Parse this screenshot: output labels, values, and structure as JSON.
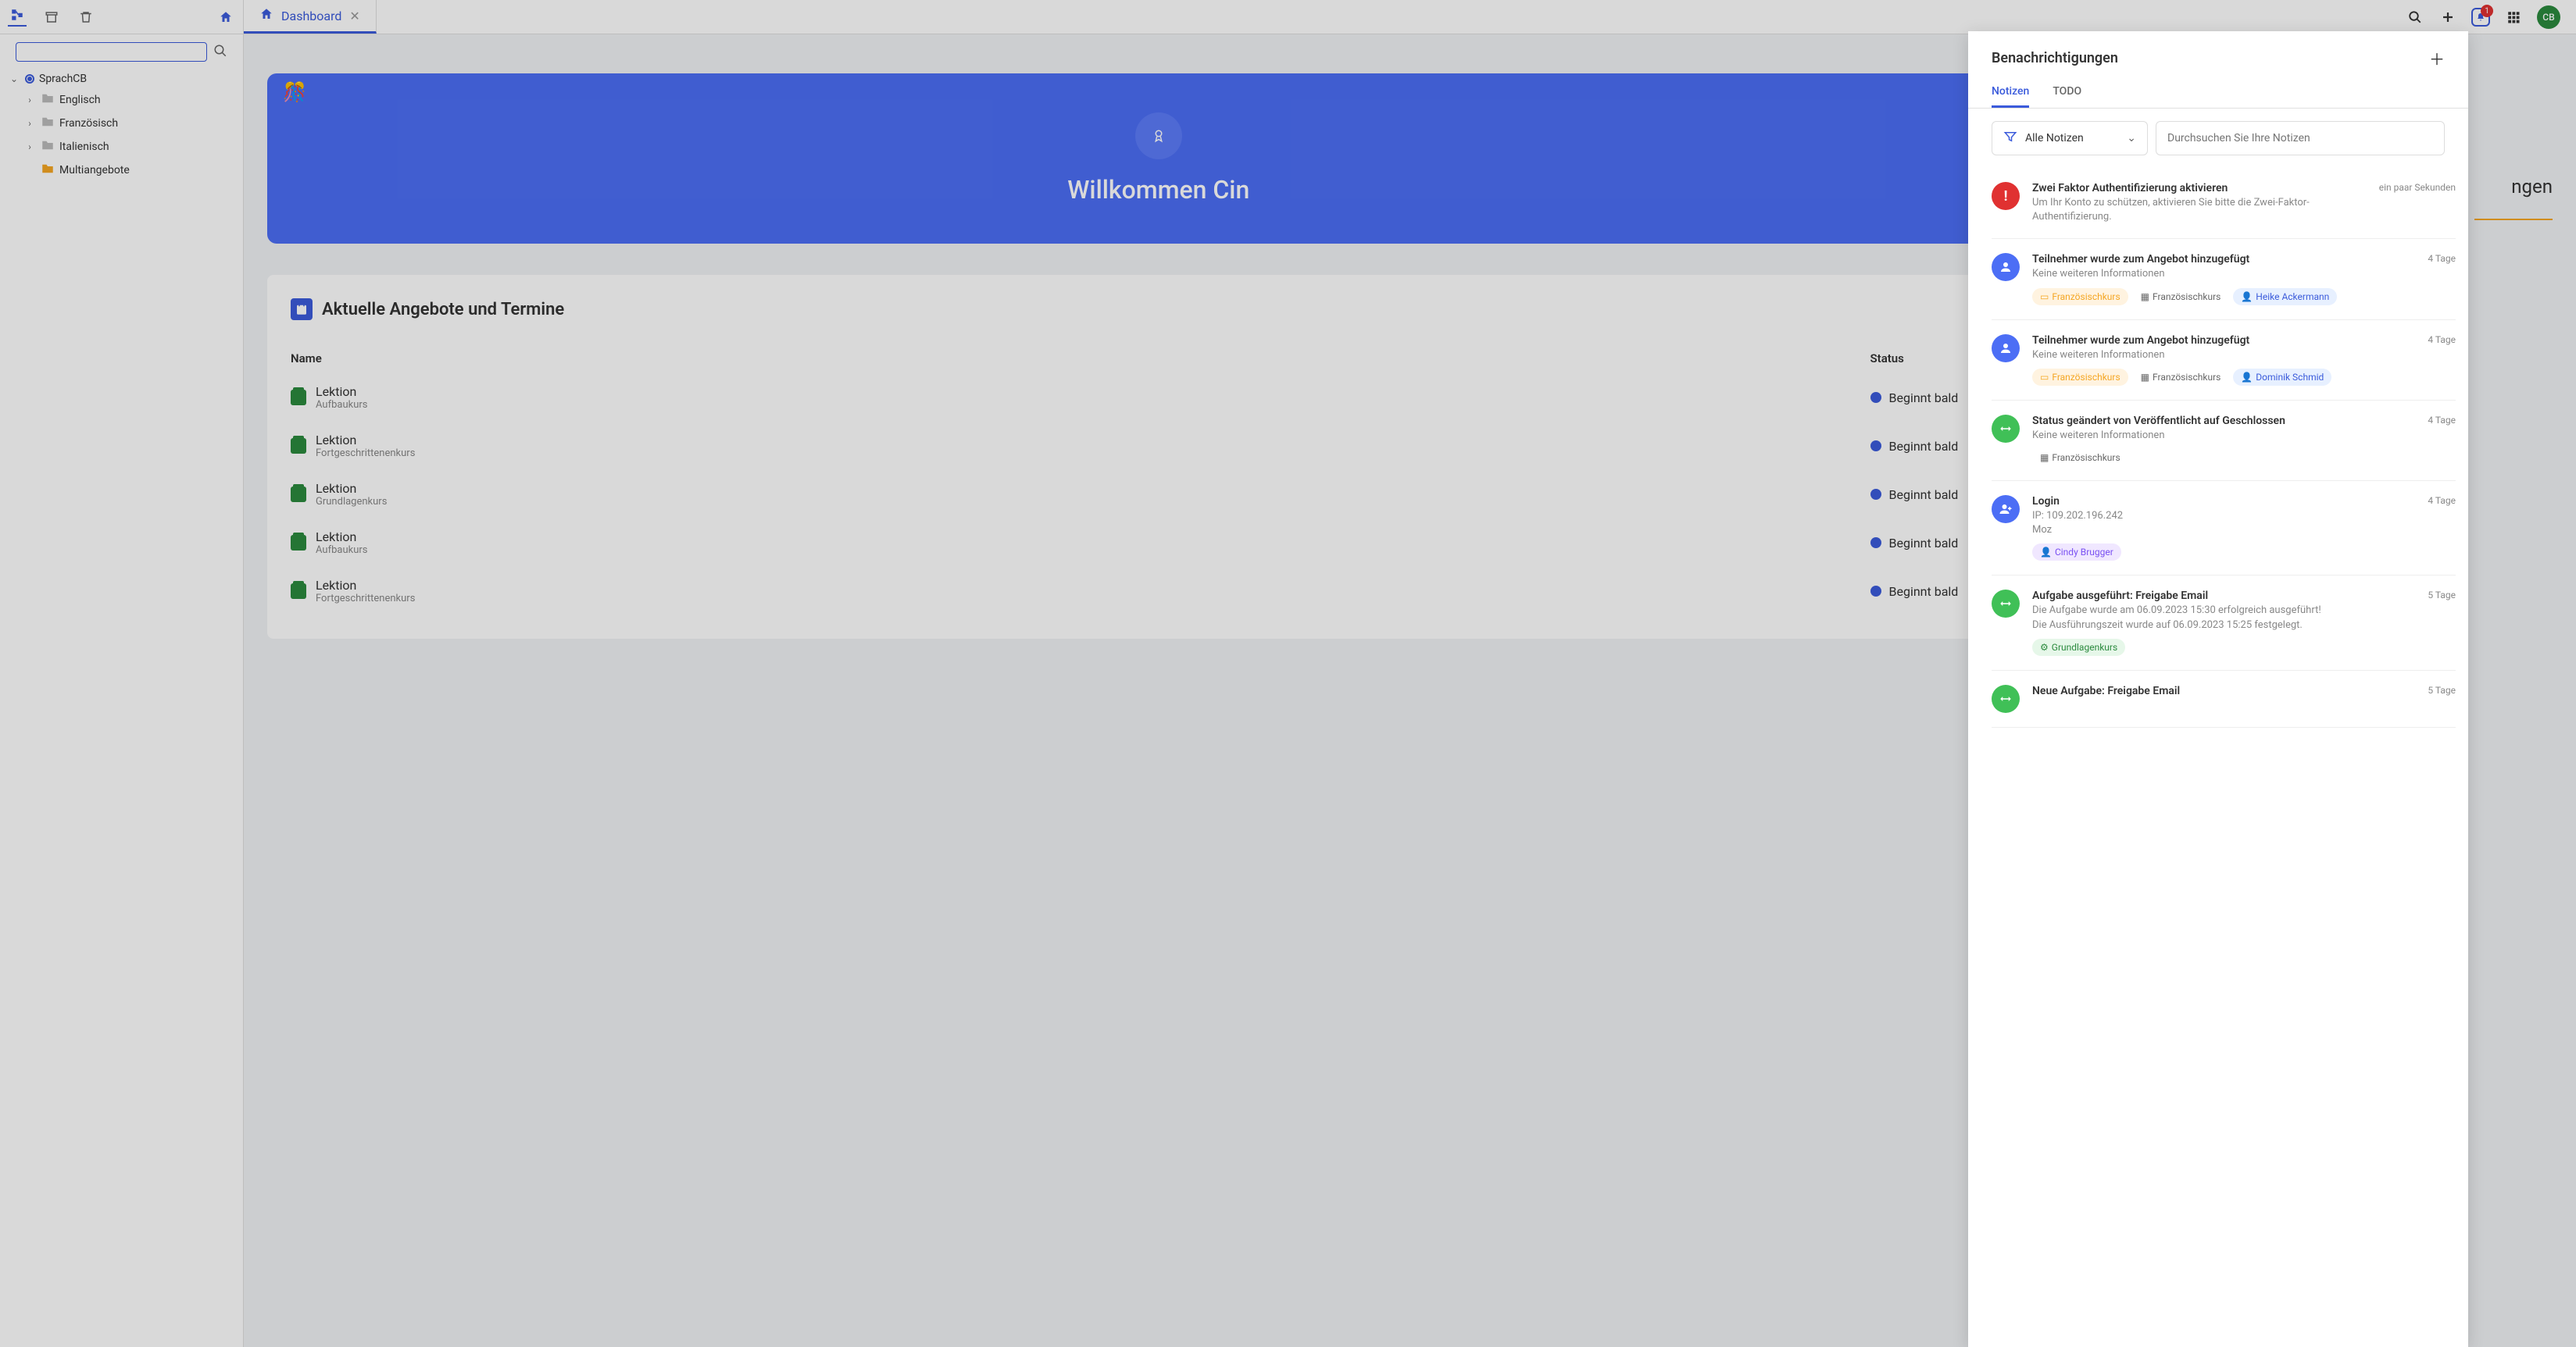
{
  "sidebar": {
    "root": "SprachCB",
    "items": [
      "Englisch",
      "Französisch",
      "Italienisch"
    ],
    "special": "Multiangebote"
  },
  "tab": {
    "label": "Dashboard"
  },
  "welcome": {
    "text": "Willkommen Cin"
  },
  "section": {
    "title": "Aktuelle Angebote und Termine",
    "col_name": "Name",
    "col_status": "Status",
    "rows": [
      {
        "title": "Lektion",
        "sub": "Aufbaukurs",
        "status": "Beginnt bald"
      },
      {
        "title": "Lektion",
        "sub": "Fortgeschrittenenkurs",
        "status": "Beginnt bald"
      },
      {
        "title": "Lektion",
        "sub": "Grundlagenkurs",
        "status": "Beginnt bald"
      },
      {
        "title": "Lektion",
        "sub": "Aufbaukurs",
        "status": "Beginnt bald"
      },
      {
        "title": "Lektion",
        "sub": "Fortgeschrittenenkurs",
        "status": "Beginnt bald"
      }
    ]
  },
  "topbar": {
    "badge": "1",
    "avatar": "CB"
  },
  "side_text": "ngen",
  "panel": {
    "title": "Benachrichtigungen",
    "tab_notes": "Notizen",
    "tab_todo": "TODO",
    "filter_label": "Alle Notizen",
    "search_placeholder": "Durchsuchen Sie Ihre Notizen",
    "items": [
      {
        "icon": "red",
        "glyph": "!",
        "title": "Zwei Faktor Authentifizierung aktivieren",
        "desc": "Um Ihr Konto zu schützen, aktivieren Sie bitte die Zwei-Faktor-Authentifizierung.",
        "time": "ein paar Sekunden",
        "tags": []
      },
      {
        "icon": "blue",
        "glyph": "person",
        "title": "Teilnehmer wurde zum Angebot hinzugefügt",
        "desc": "Keine weiteren Informationen",
        "time": "4 Tage",
        "tags": [
          {
            "cls": "orange",
            "icon": "card",
            "text": "Französischkurs"
          },
          {
            "cls": "gray",
            "icon": "grid",
            "text": "Französischkurs"
          },
          {
            "cls": "blue",
            "icon": "person",
            "text": "Heike Ackermann"
          }
        ]
      },
      {
        "icon": "blue",
        "glyph": "person",
        "title": "Teilnehmer wurde zum Angebot hinzugefügt",
        "desc": "Keine weiteren Informationen",
        "time": "4 Tage",
        "tags": [
          {
            "cls": "orange",
            "icon": "card",
            "text": "Französischkurs"
          },
          {
            "cls": "gray",
            "icon": "grid",
            "text": "Französischkurs"
          },
          {
            "cls": "blue",
            "icon": "person",
            "text": "Dominik Schmid"
          }
        ]
      },
      {
        "icon": "green",
        "glyph": "swap",
        "title": "Status geändert von Veröffentlicht auf Geschlossen",
        "desc": "Keine weiteren Informationen",
        "time": "4 Tage",
        "tags": [
          {
            "cls": "gray",
            "icon": "grid",
            "text": "Französischkurs"
          }
        ]
      },
      {
        "icon": "blue",
        "glyph": "person-add",
        "title": "Login",
        "desc": "IP: 109.202.196.242\nMoz",
        "time": "4 Tage",
        "tags": [
          {
            "cls": "purple",
            "icon": "person",
            "text": "Cindy Brugger"
          }
        ]
      },
      {
        "icon": "green",
        "glyph": "swap",
        "title": "Aufgabe ausgeführt: Freigabe Email",
        "desc": "Die Aufgabe wurde am 06.09.2023 15:30 erfolgreich ausgeführt!\nDie Ausführungszeit wurde auf 06.09.2023 15:25 festgelegt.",
        "time": "5 Tage",
        "tags": [
          {
            "cls": "green",
            "icon": "gear",
            "text": "Grundlagenkurs"
          }
        ]
      },
      {
        "icon": "green",
        "glyph": "swap",
        "title": "Neue Aufgabe: Freigabe Email",
        "desc": "",
        "time": "5 Tage",
        "tags": []
      }
    ]
  }
}
